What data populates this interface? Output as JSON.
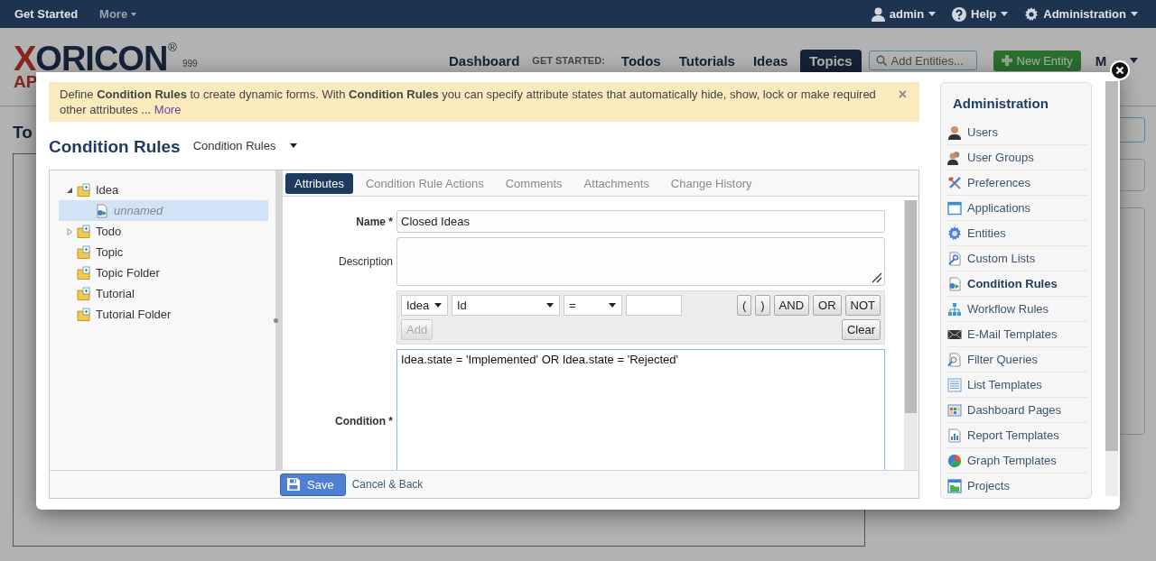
{
  "top_bar": {
    "links": [
      {
        "label": "Get Started",
        "dropdown": false
      },
      {
        "label": "More",
        "dropdown": true
      }
    ],
    "menus": [
      {
        "label": "admin"
      },
      {
        "label": "Help"
      },
      {
        "label": "Administration"
      }
    ]
  },
  "header": {
    "logo": "XORICON",
    "logo_mark": "®",
    "logo_sub": "AP",
    "logo_version": "999",
    "nav": [
      {
        "label": "Dashboard",
        "kind": "link",
        "selected": false
      },
      {
        "label": "GET STARTED:",
        "kind": "caption"
      },
      {
        "label": "Todos",
        "kind": "link",
        "selected": false
      },
      {
        "label": "Tutorials",
        "kind": "link",
        "selected": false
      },
      {
        "label": "Ideas",
        "kind": "link",
        "selected": false
      },
      {
        "label": "Topics",
        "kind": "link",
        "selected": true
      }
    ],
    "search": {
      "placeholder": "Add Entities..."
    },
    "new_button": "New Entity",
    "more_menu": "M"
  },
  "page_title": "To",
  "modal": {
    "notice": {
      "text": "Define **Condition Rules** to create dynamic forms. With **Condition Rules** you can specify attribute states that automatically hide, show, lock or make required other attributes ...",
      "link": "More",
      "close": "×"
    },
    "title": "Condition Rules",
    "type_select": "Condition Rules",
    "tree": [
      {
        "label": "Idea",
        "kind": "entity",
        "expanded": true,
        "selected": false,
        "children": [
          {
            "label": "unnamed",
            "kind": "rule",
            "selected": true
          }
        ]
      },
      {
        "label": "Todo",
        "kind": "entity",
        "expanded": false,
        "selected": false
      },
      {
        "label": "Topic",
        "kind": "entity",
        "selected": false
      },
      {
        "label": "Topic Folder",
        "kind": "entity",
        "selected": false
      },
      {
        "label": "Tutorial",
        "kind": "entity",
        "selected": false
      },
      {
        "label": "Tutorial Folder",
        "kind": "entity",
        "selected": false
      }
    ],
    "tabs": [
      {
        "label": "Attributes",
        "selected": true
      },
      {
        "label": "Condition Rule Actions",
        "selected": false
      },
      {
        "label": "Comments",
        "selected": false
      },
      {
        "label": "Attachments",
        "selected": false
      },
      {
        "label": "Change History",
        "selected": false
      }
    ],
    "name": {
      "label": "Name *",
      "value": "Closed Ideas"
    },
    "description": {
      "label": "Description"
    },
    "builder": {
      "selects": [
        "Idea",
        "Id",
        "="
      ],
      "operators": [
        "(",
        ")",
        "AND",
        "OR",
        "NOT"
      ],
      "add": {
        "label": "Add",
        "disabled": true
      },
      "clear": "Clear"
    },
    "condition": {
      "label": "Condition *",
      "value": "Idea.state = 'Implemented' OR Idea.state = 'Rejected'"
    },
    "footer": {
      "save": "Save",
      "cancel": "Cancel & Back"
    }
  },
  "admin_panel": {
    "title": "Administration",
    "items": [
      {
        "label": "Users",
        "selected": false
      },
      {
        "label": "User Groups",
        "selected": false
      },
      {
        "label": "Preferences",
        "selected": false
      },
      {
        "label": "Applications",
        "selected": false
      },
      {
        "label": "Entities",
        "selected": false
      },
      {
        "label": "Custom Lists",
        "selected": false
      },
      {
        "label": "Condition Rules",
        "selected": true
      },
      {
        "label": "Workflow Rules",
        "selected": false
      },
      {
        "label": "E-Mail Templates",
        "selected": false
      },
      {
        "label": "Filter Queries",
        "selected": false
      },
      {
        "label": "List Templates",
        "selected": false
      },
      {
        "label": "Dashboard Pages",
        "selected": false
      },
      {
        "label": "Report Templates",
        "selected": false
      },
      {
        "label": "Graph Templates",
        "selected": false
      },
      {
        "label": "Projects",
        "selected": false
      }
    ]
  }
}
